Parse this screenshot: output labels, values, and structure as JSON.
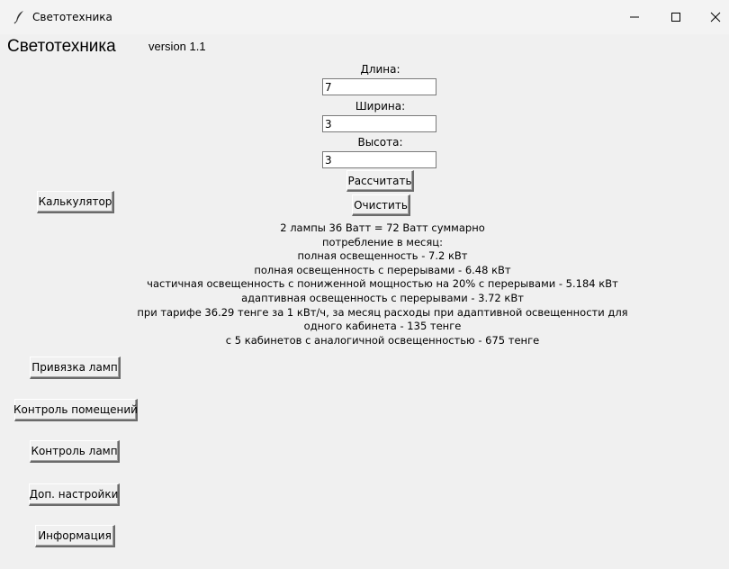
{
  "window": {
    "title": "Светотехника"
  },
  "header": {
    "app_title": "Светотехника",
    "version": "version 1.1"
  },
  "form": {
    "length_label": "Длина:",
    "length_value": "7",
    "width_label": "Ширина:",
    "width_value": "3",
    "height_label": "Высота:",
    "height_value": "3",
    "calculate_label": "Рассчитать",
    "clear_label": "Очистить"
  },
  "sidebar": {
    "calculator": "Калькулятор",
    "lamp_binding": "Привязка ламп",
    "room_control": "Контроль помещений",
    "lamp_control": "Контроль ламп",
    "extra_settings": "Доп. настройки",
    "info": "Информация"
  },
  "results": {
    "lines": [
      "2 лампы 36 Ватт = 72 Ватт суммарно",
      "потребление в месяц:",
      "полная освещенность - 7.2 кВт",
      "полная освещенность с перерывами - 6.48 кВт",
      "частичная освещенность с пониженной мощностью на 20% с перерывами - 5.184 кВт",
      "адаптивная освещенность с перерывами - 3.72 кВт",
      "при тарифе 36.29 тенге за 1 кВт/ч, за месяц расходы при адаптивной освещенности для",
      "одного кабинета - 135 тенге",
      "с 5 кабинетов с аналогичной освещенностью - 675 тенге"
    ]
  }
}
